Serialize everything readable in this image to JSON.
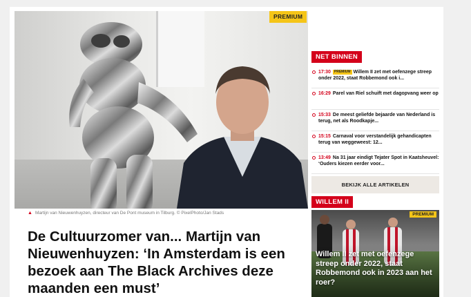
{
  "article": {
    "premium_label": "PREMIUM",
    "caption": "Martijn van Nieuwenhuyzen, directeur van De Pont museum in Tilburg. © PixelPhoto/Jan Stads",
    "headline": "De Cultuurzomer van... Martijn van Nieuwenhuyzen: ‘In Amsterdam is een bezoek aan The Black Archives deze maanden een must’"
  },
  "sidebar": {
    "section_label": "NET BINNEN",
    "items": [
      {
        "time": "17:30",
        "badge": "PREMIUM",
        "text": "Willem II zet met oefenzege streep onder 2022, staat Robbemond ook i..."
      },
      {
        "time": "16:29",
        "badge": "",
        "text": "Parel van Riel schuift met dagopvang weer op"
      },
      {
        "time": "15:33",
        "badge": "",
        "text": "De meest geliefde bejaarde van Nederland is terug, net als Roodkapje..."
      },
      {
        "time": "15:15",
        "badge": "",
        "text": "Carnaval voor verstandelijk gehandicapten terug van weggeweest: 12..."
      },
      {
        "time": "13:49",
        "badge": "",
        "text": "Na 31 jaar eindigt Tejater Spot in Kaatsheuvel: ‘Ouders kiezen eerder voor..."
      }
    ],
    "all_articles_label": "BEKIJK ALLE ARTIKELEN"
  },
  "club": {
    "section_label": "WILLEM II",
    "premium_label": "PREMIUM",
    "title": "Willem II zet met oefenzege streep onder 2022, staat Robbemond ook in 2023 aan het roer?"
  },
  "colors": {
    "accent": "#d4001a",
    "premium": "#f5c518"
  }
}
